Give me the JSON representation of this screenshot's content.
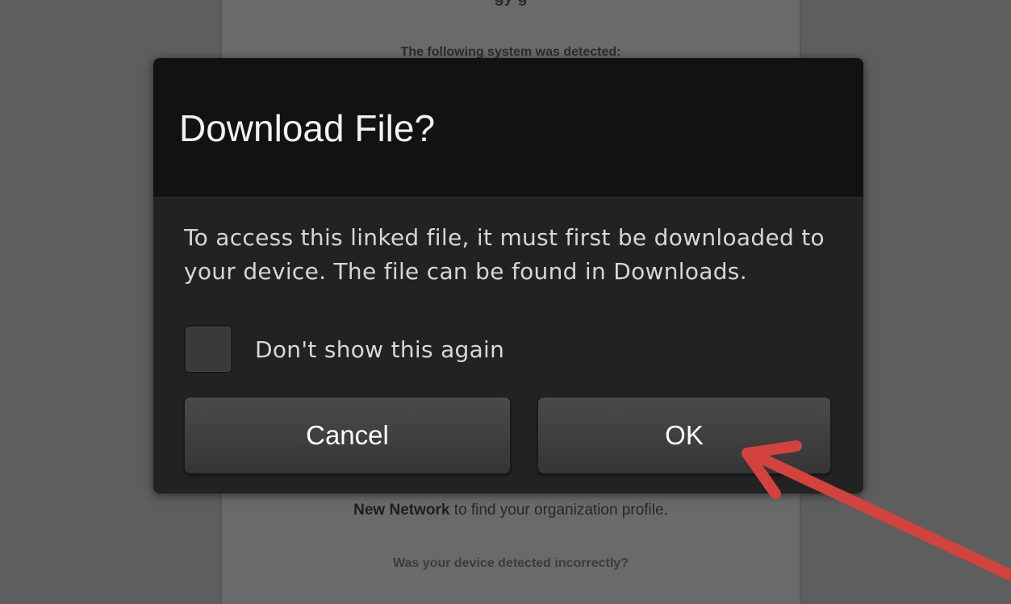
{
  "background": {
    "top_clipped_text": "gy                      g",
    "detected_text": "The following system was detected:",
    "network_line": {
      "bold": "New Network",
      "rest": " to find your organization profile."
    },
    "incorrect_text": "Was your device detected incorrectly?"
  },
  "dialog": {
    "title": "Download File?",
    "message": "To access this linked file, it must first be downloaded to your device. The file can be found in Downloads.",
    "checkbox_label": "Don't show this again",
    "checkbox_checked": false,
    "cancel_label": "Cancel",
    "ok_label": "OK"
  },
  "annotation": {
    "arrow_color": "#d1433c",
    "points_to": "ok-button"
  }
}
